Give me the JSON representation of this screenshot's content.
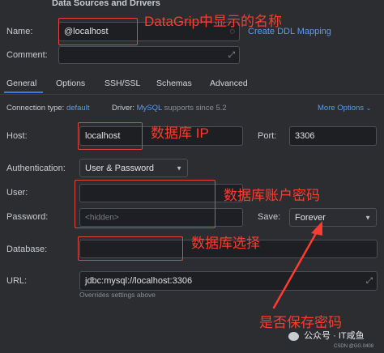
{
  "header": {
    "title": "Data Sources and Drivers"
  },
  "name": {
    "label": "Name:",
    "value": "@localhost",
    "link": "Create DDL Mapping"
  },
  "comment": {
    "label": "Comment:",
    "value": ""
  },
  "tabs": [
    "General",
    "Options",
    "SSH/SSL",
    "Schemas",
    "Advanced"
  ],
  "info": {
    "conn_type_label": "Connection type:",
    "conn_type_value": "default",
    "driver_label": "Driver:",
    "driver_value": "MySQL",
    "driver_note": "supports since 5.2",
    "more_options": "More Options"
  },
  "host": {
    "label": "Host:",
    "value": "localhost",
    "port_label": "Port:",
    "port_value": "3306"
  },
  "auth": {
    "label": "Authentication:",
    "value": "User & Password"
  },
  "user": {
    "label": "User:",
    "value": ""
  },
  "password": {
    "label": "Password:",
    "placeholder": "<hidden>",
    "save_label": "Save:",
    "save_value": "Forever"
  },
  "database": {
    "label": "Database:",
    "value": ""
  },
  "url": {
    "label": "URL:",
    "value": "jdbc:mysql://localhost:3306",
    "note": "Overrides settings above"
  },
  "annotations": {
    "name": "DataGrip中显示的名称",
    "ip": "数据库 IP",
    "account": "数据库账户密码",
    "database": "数据库选择",
    "save": "是否保存密码"
  },
  "watermark": {
    "text": "公众号 · IT咸鱼",
    "small": "CSDN @GG.0408"
  },
  "colors": {
    "annotation": "#ff3b2f",
    "link": "#5a9bf6",
    "background": "#2b2d30",
    "field": "#1e1f22"
  },
  "icons": [
    "expand-icon",
    "chevron-down-icon",
    "wechat-icon",
    "arrow-icon"
  ]
}
